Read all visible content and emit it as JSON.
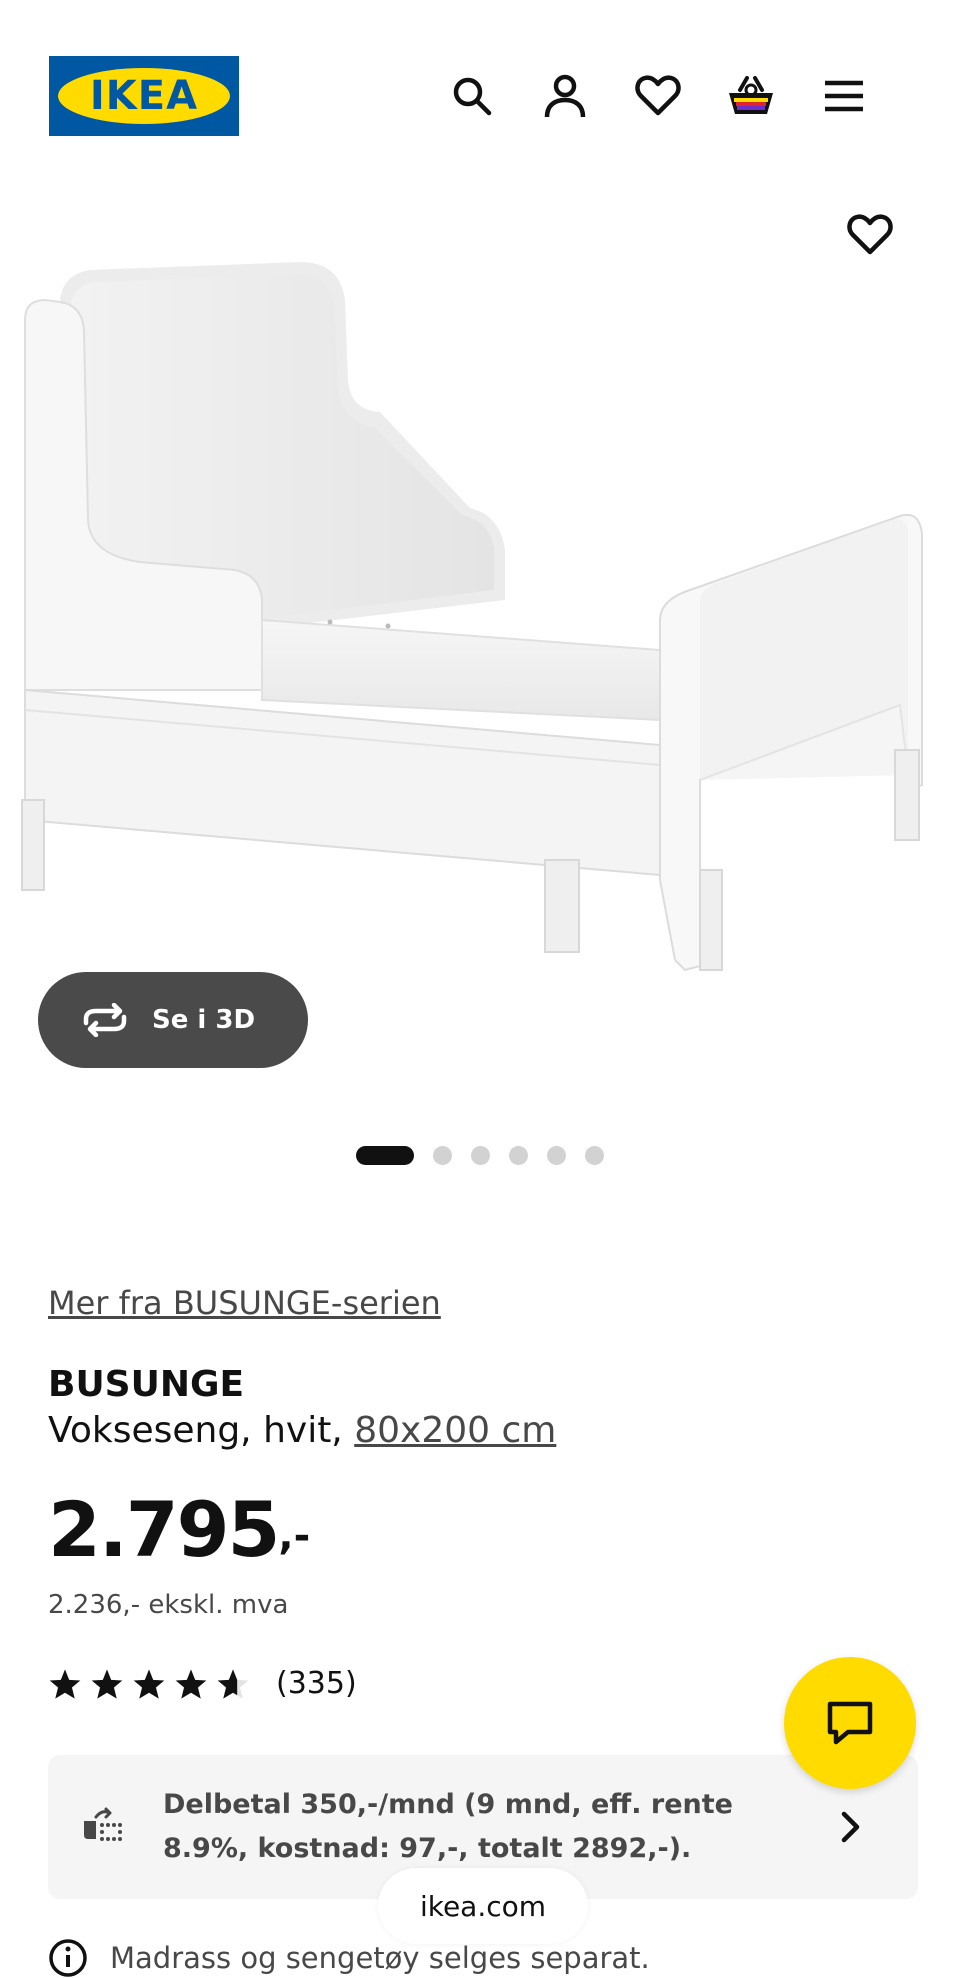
{
  "header": {
    "logo_text": "IKEA",
    "icons": [
      "search-icon",
      "account-icon",
      "favourites-icon",
      "shopping-bag-icon",
      "menu-icon"
    ]
  },
  "gallery": {
    "view_3d_label": "Se i 3D",
    "image_count": 6,
    "active_index": 0
  },
  "product": {
    "series_link": "Mer fra BUSUNGE-serien",
    "name": "BUSUNGE",
    "description": "Vokseseng, hvit, ",
    "size": "80x200 cm",
    "price_main": "2.795",
    "price_suffix": ",-",
    "price_ex_vat": "2.236,- ekskl. mva",
    "rating_value": 4.6,
    "rating_count": "(335)"
  },
  "finance": {
    "text": "Delbetal 350,-/mnd (9 mnd, eff. rente 8.9%, kostnad: 97,-, totalt 2892,-)."
  },
  "browser": {
    "url": "ikea.com"
  },
  "notice": {
    "text": "Madrass og sengetøy selges separat."
  },
  "colors": {
    "ikea_blue": "#0058a3",
    "ikea_yellow": "#ffdb00"
  }
}
